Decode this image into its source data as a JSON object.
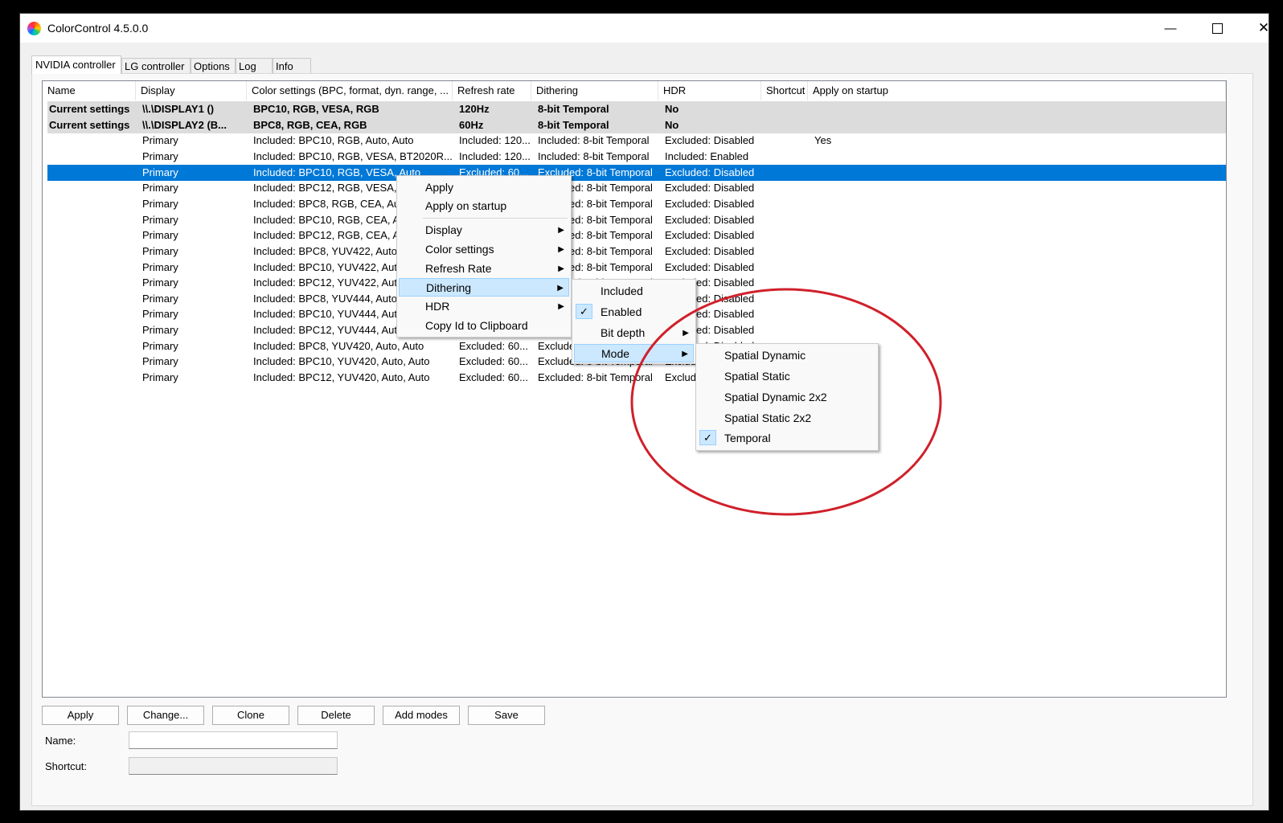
{
  "window": {
    "title": "ColorControl 4.5.0.0"
  },
  "tabs": [
    "NVIDIA controller",
    "LG controller",
    "Options",
    "Log",
    "Info"
  ],
  "columns": [
    "Name",
    "Display",
    "Color settings (BPC, format, dyn. range, ...",
    "Refresh rate",
    "Dithering",
    "HDR",
    "Shortcut",
    "Apply on startup"
  ],
  "rows": [
    [
      "Current settings",
      "\\\\.\\DISPLAY1 ()",
      "BPC10, RGB, VESA, RGB",
      "120Hz",
      "8-bit Temporal",
      "No",
      "",
      ""
    ],
    [
      "Current settings",
      "\\\\.\\DISPLAY2 (B...",
      "BPC8, RGB, CEA, RGB",
      "60Hz",
      "8-bit Temporal",
      "No",
      "",
      ""
    ],
    [
      "",
      "Primary",
      "Included: BPC10, RGB, Auto, Auto",
      "Included: 120...",
      "Included: 8-bit Temporal",
      "Excluded: Disabled",
      "",
      "Yes"
    ],
    [
      "",
      "Primary",
      "Included: BPC10, RGB, VESA, BT2020R...",
      "Included: 120...",
      "Included: 8-bit Temporal",
      "Included: Enabled",
      "",
      ""
    ],
    [
      "",
      "Primary",
      "Included: BPC10, RGB, VESA, Auto",
      "Excluded: 60...",
      "Excluded: 8-bit Temporal",
      "Excluded: Disabled",
      "",
      ""
    ],
    [
      "",
      "Primary",
      "Included: BPC12, RGB, VESA, Auto",
      "",
      "Excluded: 8-bit Temporal",
      "Excluded: Disabled",
      "",
      ""
    ],
    [
      "",
      "Primary",
      "Included: BPC8, RGB, CEA, Auto",
      "",
      "Excluded: 8-bit Temporal",
      "Excluded: Disabled",
      "",
      ""
    ],
    [
      "",
      "Primary",
      "Included: BPC10, RGB, CEA, Auto",
      "",
      "Excluded: 8-bit Temporal",
      "Excluded: Disabled",
      "",
      ""
    ],
    [
      "",
      "Primary",
      "Included: BPC12, RGB, CEA, Auto",
      "",
      "Excluded: 8-bit Temporal",
      "Excluded: Disabled",
      "",
      ""
    ],
    [
      "",
      "Primary",
      "Included: BPC8, YUV422, Auto",
      "",
      "Excluded: 8-bit Temporal",
      "Excluded: Disabled",
      "",
      ""
    ],
    [
      "",
      "Primary",
      "Included: BPC10, YUV422, Auto",
      "",
      "Excluded: 8-bit Temporal",
      "Excluded: Disabled",
      "",
      ""
    ],
    [
      "",
      "Primary",
      "Included: BPC12, YUV422, Auto",
      "",
      "Excluded: 8-bit Temporal",
      "Excluded: Disabled",
      "",
      ""
    ],
    [
      "",
      "Primary",
      "Included: BPC8, YUV444, Auto",
      "",
      "Excluded: 8-bit Temporal",
      "Excluded: Disabled",
      "",
      ""
    ],
    [
      "",
      "Primary",
      "Included: BPC10, YUV444, Auto",
      "",
      "Excluded: 8-bit Temporal",
      "Excluded: Disabled",
      "",
      ""
    ],
    [
      "",
      "Primary",
      "Included: BPC12, YUV444, Auto, Auto",
      "",
      "Excluded: 8-bit Temporal",
      "Excluded: Disabled",
      "",
      ""
    ],
    [
      "",
      "Primary",
      "Included: BPC8, YUV420, Auto, Auto",
      "Excluded: 60...",
      "Excluded: 8-bit Temporal",
      "Excluded: Disabled",
      "",
      ""
    ],
    [
      "",
      "Primary",
      "Included: BPC10, YUV420, Auto, Auto",
      "Excluded: 60...",
      "Excluded: 8-bit Temporal",
      "Excluded: Disabled",
      "",
      ""
    ],
    [
      "",
      "Primary",
      "Included: BPC12, YUV420, Auto, Auto",
      "Excluded: 60...",
      "Excluded: 8-bit Temporal",
      "Excluded: Disabled",
      "",
      ""
    ]
  ],
  "buttons": [
    "Apply",
    "Change...",
    "Clone",
    "Delete",
    "Add modes",
    "Save"
  ],
  "fields": {
    "name_label": "Name:",
    "shortcut_label": "Shortcut:",
    "name_value": "",
    "shortcut_value": ""
  },
  "context_menu": {
    "items": [
      "Apply",
      "Apply on startup",
      "Display",
      "Color settings",
      "Refresh Rate",
      "Dithering",
      "HDR",
      "Copy Id to Clipboard"
    ]
  },
  "dithering_menu": {
    "items": [
      "Included",
      "Enabled",
      "Bit depth",
      "Mode"
    ]
  },
  "mode_menu": {
    "items": [
      "Spatial Dynamic",
      "Spatial Static",
      "Spatial Dynamic 2x2",
      "Spatial Static 2x2",
      "Temporal"
    ]
  },
  "annotation_color": "#d0202a",
  "selection_color": "#0078d7"
}
